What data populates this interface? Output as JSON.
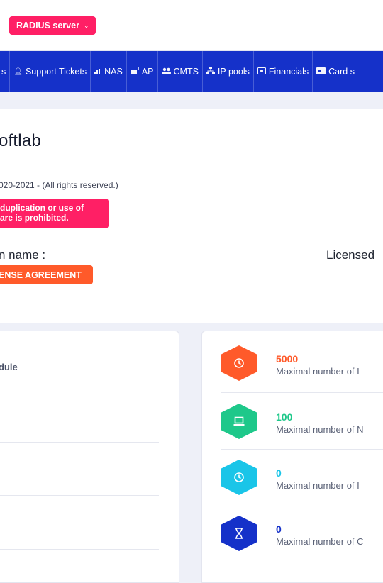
{
  "topbar": {
    "server_button": "RADIUS server",
    "server_button_icon": "chevron-down-icon"
  },
  "nav": [
    {
      "label": "s",
      "icon": ""
    },
    {
      "label": "Support Tickets",
      "icon": "user-icon"
    },
    {
      "label": "NAS",
      "icon": "signal-icon"
    },
    {
      "label": "AP",
      "icon": "access-point-icon"
    },
    {
      "label": "CMTS",
      "icon": "users-icon"
    },
    {
      "label": "IP pools",
      "icon": "network-icon"
    },
    {
      "label": "Financials",
      "icon": "money-icon"
    },
    {
      "label": "Card s",
      "icon": "card-icon"
    }
  ],
  "header": {
    "brand": "oftlab",
    "copyright": "020-2021 - (All rights reserved.)",
    "warning_line1": "duplication or use of",
    "warning_line2": "are is prohibited.",
    "company_label": "n name :",
    "licensed_label": "Licensed",
    "license_button": "ENSE AGREEMENT"
  },
  "modules": {
    "header": "dule"
  },
  "stats": [
    {
      "value": "5000",
      "label": "Maximal number of I",
      "color": "#ff5a2a",
      "icon": "clock-icon"
    },
    {
      "value": "100",
      "label": "Maximal number of N",
      "color": "#1ec88a",
      "icon": "laptop-icon"
    },
    {
      "value": "0",
      "label": "Maximal number of I",
      "color": "#1ac5e8",
      "icon": "clock-icon"
    },
    {
      "value": "0",
      "label": "Maximal number of C",
      "color": "#1531c9",
      "icon": "hourglass-icon"
    }
  ]
}
